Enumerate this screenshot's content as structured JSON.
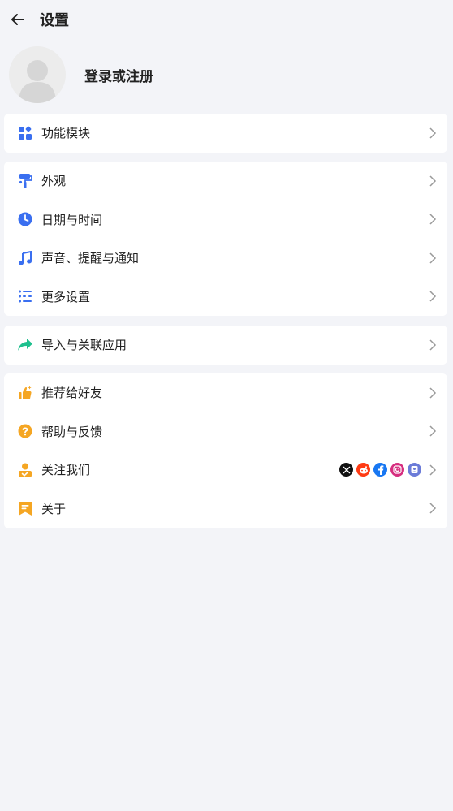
{
  "header": {
    "title": "设置",
    "back_icon": "arrow-left-icon"
  },
  "profile": {
    "login_label": "登录或注册",
    "avatar_icon": "user-avatar-icon"
  },
  "groups": [
    {
      "items": [
        {
          "label": "功能模块",
          "icon": "widgets-icon",
          "color": "#3a6ff0"
        }
      ]
    },
    {
      "items": [
        {
          "label": "外观",
          "icon": "paint-roller-icon",
          "color": "#3a6ff0"
        },
        {
          "label": "日期与时间",
          "icon": "clock-icon",
          "color": "#3a6ff0"
        },
        {
          "label": "声音、提醒与通知",
          "icon": "music-note-icon",
          "color": "#3a6ff0"
        },
        {
          "label": "更多设置",
          "icon": "list-settings-icon",
          "color": "#3a6ff0"
        }
      ]
    },
    {
      "items": [
        {
          "label": "导入与关联应用",
          "icon": "share-arrow-icon",
          "color": "#1ec08e"
        }
      ]
    },
    {
      "items": [
        {
          "label": "推荐给好友",
          "icon": "thumbs-up-icon",
          "color": "#f5a623"
        },
        {
          "label": "帮助与反馈",
          "icon": "help-circle-icon",
          "color": "#f5a623"
        },
        {
          "label": "关注我们",
          "icon": "user-check-icon",
          "color": "#f5a623"
        },
        {
          "label": "关于",
          "icon": "note-icon",
          "color": "#f5a623"
        }
      ]
    }
  ],
  "social_links": [
    {
      "icon": "x-twitter-icon",
      "color": "#111111"
    },
    {
      "icon": "reddit-icon",
      "color": "#ff3b14"
    },
    {
      "icon": "facebook-icon",
      "color": "#1877f2"
    },
    {
      "icon": "instagram-icon",
      "color": "#d62e7f"
    },
    {
      "icon": "discord-icon",
      "color": "#6b7bd8"
    }
  ],
  "colors": {
    "background": "#f3f4f8",
    "card": "#ffffff",
    "accent_blue": "#3a6ff0",
    "accent_green": "#1ec08e",
    "accent_orange": "#f5a623"
  }
}
